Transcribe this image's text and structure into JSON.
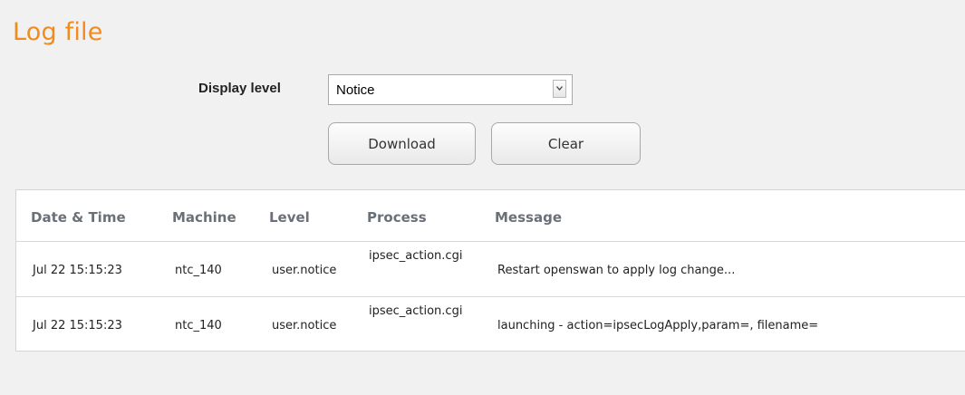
{
  "page": {
    "title": "Log file"
  },
  "display_level": {
    "label": "Display level",
    "selected": "Notice"
  },
  "buttons": {
    "download": "Download",
    "clear": "Clear"
  },
  "table": {
    "headers": {
      "datetime": "Date & Time",
      "machine": "Machine",
      "level": "Level",
      "process": "Process",
      "message": "Message"
    },
    "rows": [
      {
        "datetime": "Jul 22 15:15:23",
        "machine": "ntc_140",
        "level": "user.notice",
        "process": "ipsec_action.cgi",
        "message": "Restart openswan to apply log change..."
      },
      {
        "datetime": "Jul 22 15:15:23",
        "machine": "ntc_140",
        "level": "user.notice",
        "process": "ipsec_action.cgi",
        "message": "launching - action=ipsecLogApply,param=, filename="
      }
    ]
  },
  "colors": {
    "title": "#f08c1e",
    "header_text": "#6a7078",
    "background": "#f1f1f1"
  },
  "icons": {
    "select_arrow": "chevron-down-icon"
  }
}
